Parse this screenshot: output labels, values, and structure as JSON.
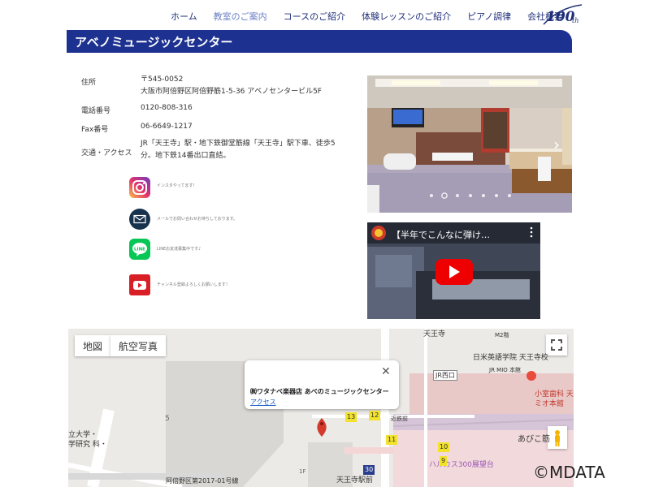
{
  "nav": {
    "items": [
      "ホーム",
      "教室のご案内",
      "コースのご紹介",
      "体験レッスンのご紹介",
      "ピアノ調律",
      "会社概要"
    ],
    "logo_text": "100th"
  },
  "banner": {
    "title": "アベノミュージックセンター"
  },
  "info": {
    "address_label": "住所",
    "postal": "〒545-0052",
    "address": "大阪市阿倍野区阿倍野筋1-5-36 アベノセンタービル5F",
    "phone_label": "電話番号",
    "phone": "0120-808-316",
    "fax_label": "Fax番号",
    "fax": "06-6649-1217",
    "access_label": "交通・アクセス",
    "access_line1": "JR「天王寺」駅・地下鉄御堂筋線「天王寺」駅下車、徒歩5",
    "access_line2": "分。地下鉄14番出口直結。"
  },
  "social": [
    {
      "icon": "instagram-icon",
      "text": "インスタやってます！"
    },
    {
      "icon": "mail-icon",
      "text": "メールでお問い合わせお待ちしております。"
    },
    {
      "icon": "line-icon",
      "text": "LINEお友達募集中です♪"
    },
    {
      "icon": "youtube-icon",
      "text": "チャンネル登録よろしくお願いします！"
    }
  ],
  "video": {
    "title": "【半年でこんなに弾け…"
  },
  "map": {
    "tab_map": "地図",
    "tab_satellite": "航空写真",
    "popup_title": "㈱ワタナベ楽器店 あべのミュージックセンター",
    "popup_link": "アクセス",
    "labels": {
      "tennoji": "天王寺",
      "nichibei": "日米英語学院 天王寺校",
      "jr_mio": "JR MIO 本館",
      "jr_nishiguchi": "JR西口",
      "dental": "小室歯科 天",
      "mio_south": "ミオ本館",
      "harukas": "ハルカス300展望台",
      "abiko": "あびこ筋",
      "tennoji_ekimae": "天王寺駅前",
      "kinmae": "近鉄前",
      "univ1": "立大学・",
      "univ2": "学研究 科・",
      "road": "阿倍野区第2017-01号線",
      "five": "5",
      "floor": "1F",
      "m2": "M2階"
    },
    "numbers": [
      "13",
      "12",
      "11",
      "10",
      "9",
      "30"
    ]
  },
  "watermark": "©MDATA"
}
